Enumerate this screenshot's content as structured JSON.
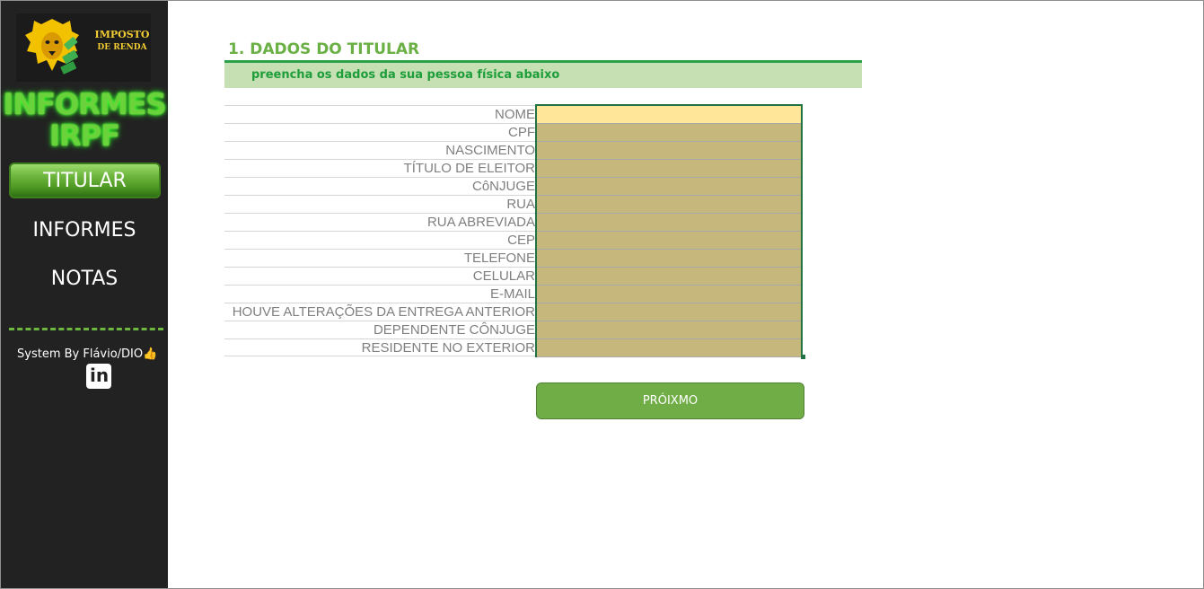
{
  "logo": {
    "line1": "IMPOSTO",
    "line2": "DE RENDA"
  },
  "brand": {
    "line1": "INFORMES",
    "line2": "IRPF"
  },
  "nav": {
    "active": "TITULAR",
    "items": [
      "INFORMES",
      "NOTAS"
    ]
  },
  "credit": "System By Flávio/DIO👍",
  "linkedin_icon": "in",
  "section": {
    "title": "1. DADOS DO TITULAR",
    "subtitle": "preencha os dados da sua pessoa física abaixo"
  },
  "fields": [
    "NOME",
    "CPF",
    "NASCIMENTO",
    "TÍTULO DE ELEITOR",
    "CôNJUGE",
    "RUA",
    "RUA ABREVIADA",
    "CEP",
    "TELEFONE",
    "CELULAR",
    "E-MAIL",
    "HOUVE ALTERAÇÕES DA ENTREGA ANTERIOR",
    "DEPENDENTE CÔNJUGE",
    "RESIDENTE NO EXTERIOR"
  ],
  "next_button": "PRÓIXMO",
  "colors": {
    "sidebar": "#222222",
    "accent_green": "#70ad47",
    "input_fill": "#c6b87d",
    "active_cell": "#ffe699"
  }
}
